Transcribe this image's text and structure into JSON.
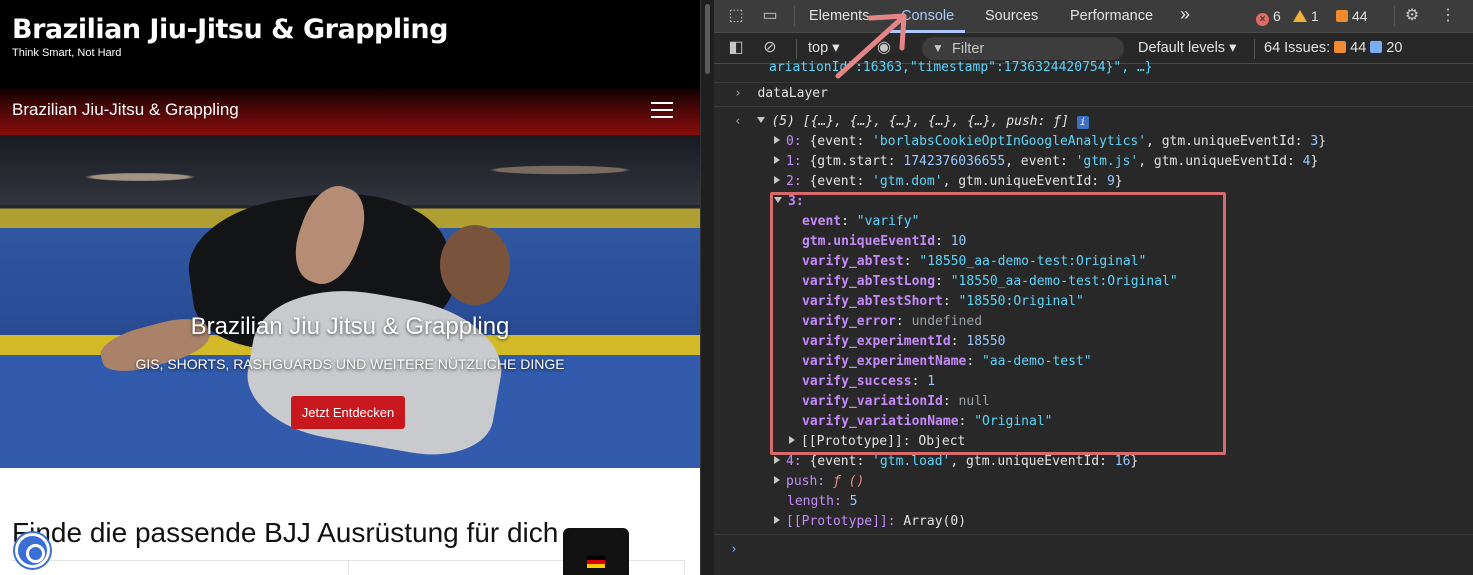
{
  "site": {
    "title": "Brazilian Jiu-Jitsu & Grappling",
    "tagline": "Think Smart, Not Hard",
    "nav_brand": "Brazilian Jiu-Jitsu & Grappling",
    "hero_title": "Brazilian Jiu Jitsu & Grappling",
    "hero_subtitle": "GIS, SHORTS, RASHGUARDS UND WEITERE NÜTZLICHE DINGE",
    "hero_button": "Jetzt Entdecken",
    "section_heading": "Finde die passende BJJ Ausrüstung für dich",
    "icons": [
      "menu-icon",
      "cookie-settings-icon",
      "flag-de-icon"
    ],
    "colors": {
      "button": "#c8171d",
      "nav_gradient_end": "#8a0c0c"
    }
  },
  "devtools": {
    "tabs": [
      "Elements",
      "Console",
      "Sources",
      "Performance"
    ],
    "active_tab": "Console",
    "more_tabs": "»",
    "errors_count": "6",
    "warnings_count": "1",
    "issues_badge_count": "44",
    "toolbar": {
      "context": "top",
      "filter_placeholder": "Filter",
      "levels": "Default levels",
      "issues_label": "64 Issues:",
      "issues_orange": "44",
      "issues_blue": "20"
    },
    "console": {
      "truncated_line": "ariationId\":16363,\"timestamp\":1736324420754}\", …}",
      "input": "dataLayer",
      "summary": "(5) [{…}, {…}, {…}, {…}, {…}, push: ƒ]",
      "info_badge": "i",
      "items": [
        {
          "idx": "0:",
          "text_pre": "{event: ",
          "str": "'borlabsCookieOptInGoogleAnalytics'",
          "text_mid": ", gtm.uniqueEventId: ",
          "num": "3",
          "text_end": "}"
        },
        {
          "idx": "1:",
          "text_pre": "{gtm.start: ",
          "num1": "1742376036655",
          "text_mid": ", event: ",
          "str": "'gtm.js'",
          "text_mid2": ", gtm.uniqueEventId: ",
          "num": "4",
          "text_end": "}"
        },
        {
          "idx": "2:",
          "text_pre": "{event: ",
          "str": "'gtm.dom'",
          "text_mid": ", gtm.uniqueEventId: ",
          "num": "9",
          "text_end": "}"
        }
      ],
      "expanded_idx": "3:",
      "props": [
        {
          "key": "event",
          "value": "\"varify\"",
          "type": "str"
        },
        {
          "key": "gtm.uniqueEventId",
          "value": "10",
          "type": "num"
        },
        {
          "key": "varify_abTest",
          "value": "\"18550_aa-demo-test:Original\"",
          "type": "str"
        },
        {
          "key": "varify_abTestLong",
          "value": "\"18550_aa-demo-test:Original\"",
          "type": "str"
        },
        {
          "key": "varify_abTestShort",
          "value": "\"18550:Original\"",
          "type": "str"
        },
        {
          "key": "varify_error",
          "value": "undefined",
          "type": "grey"
        },
        {
          "key": "varify_experimentId",
          "value": "18550",
          "type": "num"
        },
        {
          "key": "varify_experimentName",
          "value": "\"aa-demo-test\"",
          "type": "str"
        },
        {
          "key": "varify_success",
          "value": "1",
          "type": "num"
        },
        {
          "key": "varify_variationId",
          "value": "null",
          "type": "grey"
        },
        {
          "key": "varify_variationName",
          "value": "\"Original\"",
          "type": "str"
        }
      ],
      "prototype_obj": "[[Prototype]]: Object",
      "item4": {
        "idx": "4:",
        "text_pre": "{event: ",
        "str": "'gtm.load'",
        "text_mid": ", gtm.uniqueEventId: ",
        "num": "16",
        "text_end": "}"
      },
      "push_key": "push:",
      "push_val": "ƒ ()",
      "length_key": "length:",
      "length_val": "5",
      "prototype_arr_key": "[[Prototype]]:",
      "prototype_arr_val": "Array(0)",
      "prompt": "›"
    }
  }
}
